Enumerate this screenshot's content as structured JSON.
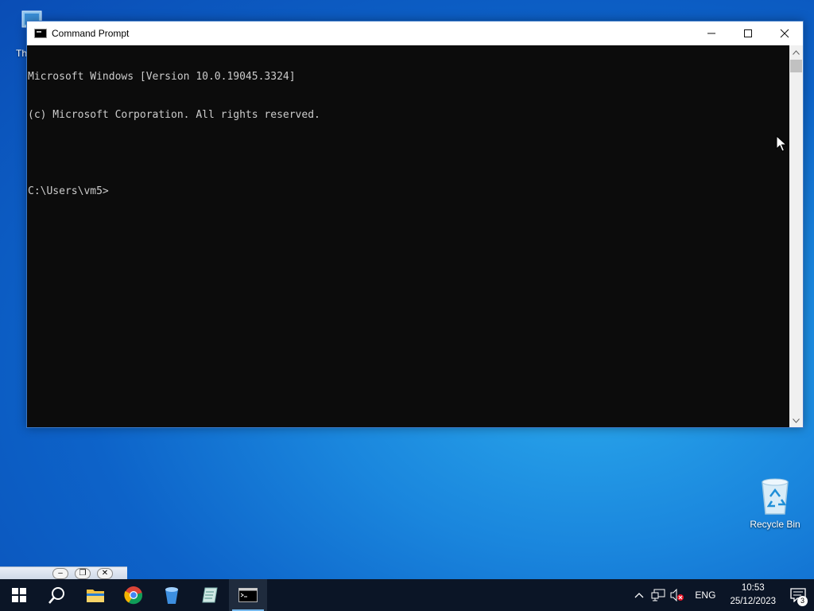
{
  "desktop": {
    "partial_icon_label": "Th",
    "recycle_bin_label": "Recycle Bin"
  },
  "window": {
    "title": "Command Prompt",
    "controls": {
      "minimize": "—",
      "maximize": "☐",
      "close": "✕"
    }
  },
  "console": {
    "lines": [
      "Microsoft Windows [Version 10.0.19045.3324]",
      "(c) Microsoft Corporation. All rights reserved.",
      "",
      "C:\\Users\\vm5>"
    ]
  },
  "minimized_strip": {
    "buttons": [
      "–",
      "❐",
      "✕"
    ]
  },
  "taskbar": {
    "items": [
      {
        "name": "start-button",
        "icon": "windows-logo-icon"
      },
      {
        "name": "search-button",
        "icon": "search-icon"
      },
      {
        "name": "file-explorer",
        "icon": "folder-icon"
      },
      {
        "name": "chrome",
        "icon": "chrome-icon"
      },
      {
        "name": "app-bucket",
        "icon": "bucket-icon"
      },
      {
        "name": "app-notepad",
        "icon": "notepad-icon"
      },
      {
        "name": "command-prompt",
        "icon": "terminal-icon",
        "active": true
      }
    ],
    "tray": {
      "language": "ENG",
      "time": "10:53",
      "date": "25/12/2023",
      "notification_count": "3"
    }
  },
  "colors": {
    "console_bg": "#0c0c0c",
    "console_text": "#cccccc",
    "taskbar_bg": "#0b1526",
    "accent": "#76b9ed"
  }
}
